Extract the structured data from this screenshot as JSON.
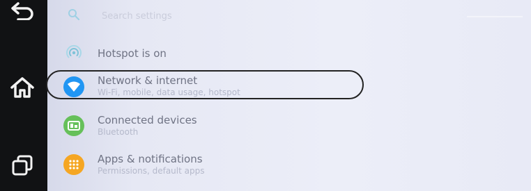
{
  "search": {
    "placeholder": "Search settings"
  },
  "items": [
    {
      "title": "Hotspot is on",
      "subtitle": "",
      "icon": "hotspot-icon",
      "color": "#7fc3d8"
    },
    {
      "title": "Network & internet",
      "subtitle": "Wi-Fi, mobile, data usage, hotspot",
      "icon": "wifi-icon",
      "color": "#2196f3"
    },
    {
      "title": "Connected devices",
      "subtitle": "Bluetooth",
      "icon": "connected-devices-icon",
      "color": "#66c05a"
    },
    {
      "title": "Apps & notifications",
      "subtitle": "Permissions, default apps",
      "icon": "apps-grid-icon",
      "color": "#f5a623"
    }
  ],
  "navbar": {
    "buttons": [
      "back-icon",
      "home-icon",
      "recents-icon"
    ]
  }
}
